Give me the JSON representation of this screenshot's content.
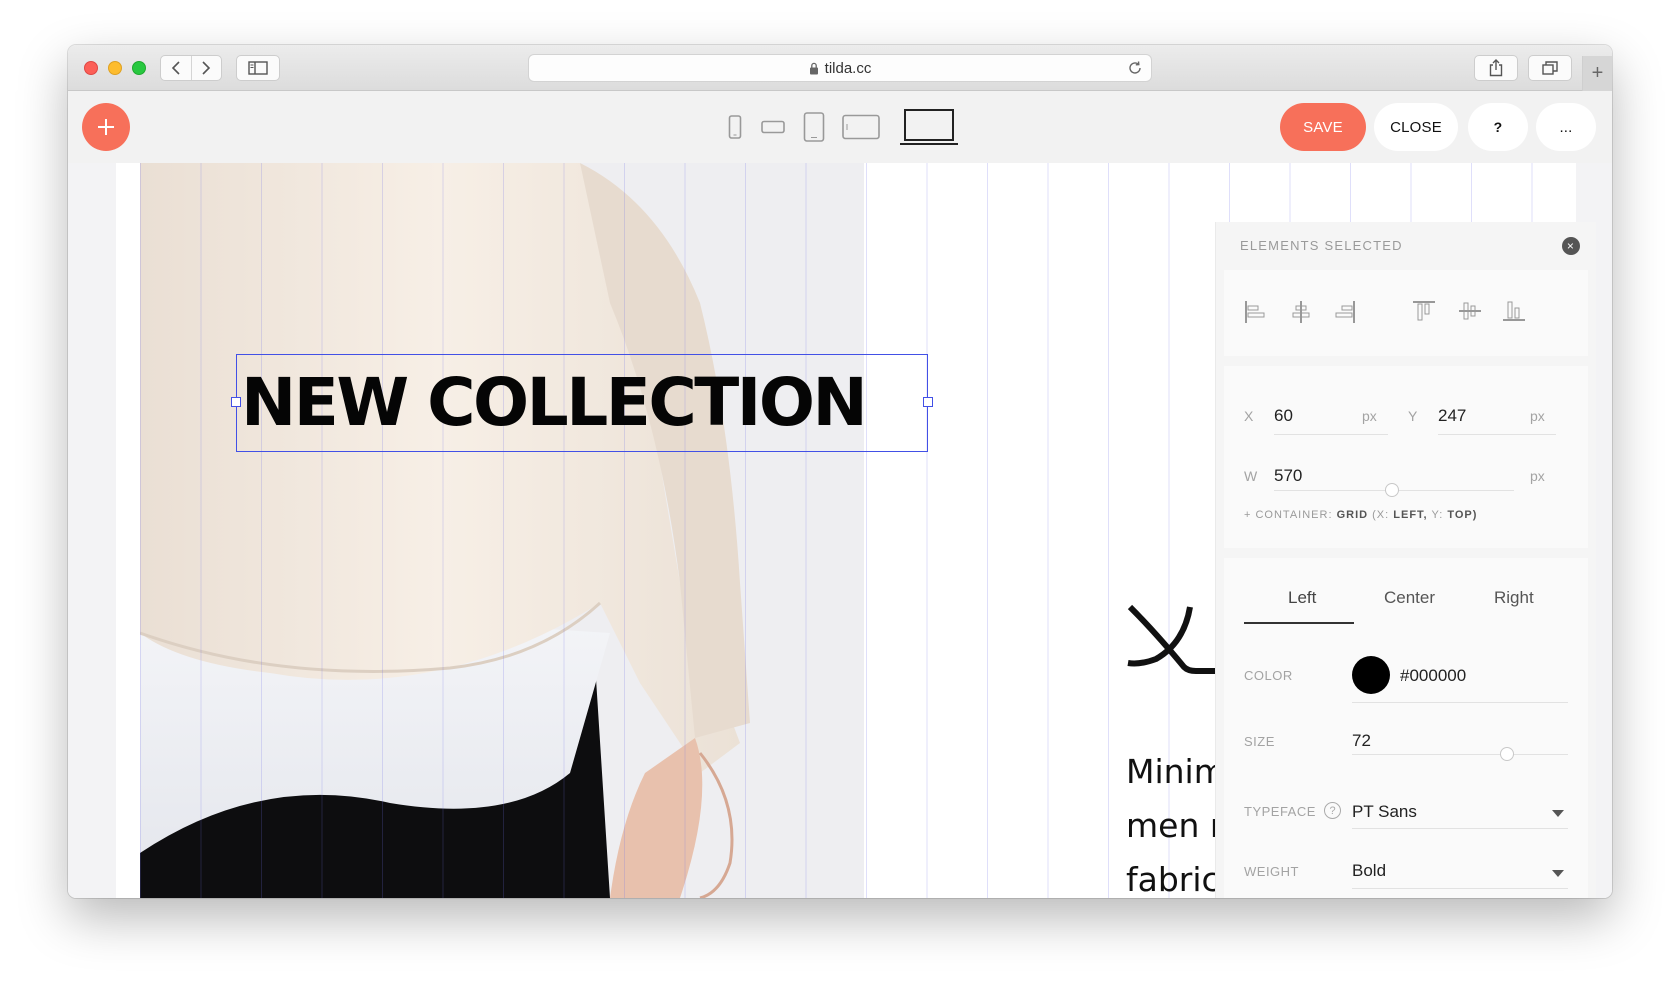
{
  "browser": {
    "url": "tilda.cc"
  },
  "toolbar": {
    "save_label": "SAVE",
    "close_label": "CLOSE",
    "help_label": "?",
    "more_label": "..."
  },
  "canvas": {
    "headline": "NEW COLLECTION",
    "body_lines": "Minimalist\nmen made\nfabrics and materials"
  },
  "panel": {
    "title": "ELEMENTS SELECTED",
    "position": {
      "x_label": "X",
      "x_value": "60",
      "x_unit": "px",
      "y_label": "Y",
      "y_value": "247",
      "y_unit": "px",
      "w_label": "W",
      "w_value": "570",
      "w_unit": "px"
    },
    "container_note": {
      "prefix": "+ CONTAINER:",
      "grid": "GRID",
      "x_part": "(X:",
      "x_val": "LEFT,",
      "y_part": "Y:",
      "y_val": "TOP)"
    },
    "typography": {
      "tabs": [
        "Left",
        "Center",
        "Right"
      ],
      "active_tab": "Left",
      "color_label": "COLOR",
      "color_value": "#000000",
      "size_label": "SIZE",
      "size_value": "72",
      "typeface_label": "TYPEFACE",
      "typeface_value": "PT Sans",
      "weight_label": "WEIGHT",
      "weight_value": "Bold"
    }
  },
  "colors": {
    "accent": "#f7705a",
    "selection": "#4250e6"
  }
}
